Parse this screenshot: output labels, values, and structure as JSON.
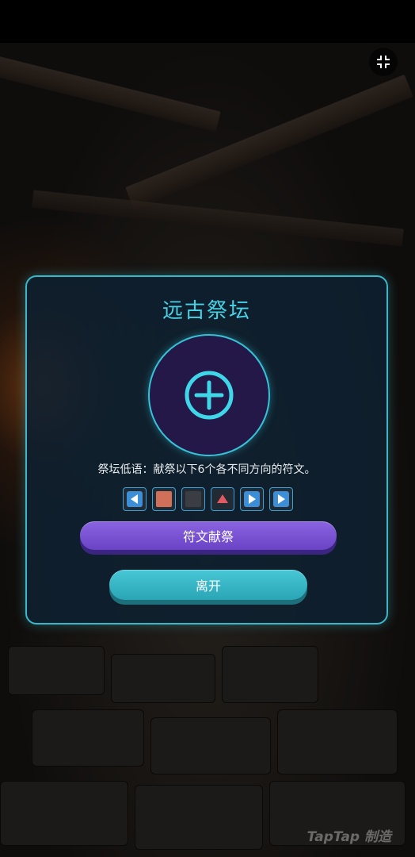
{
  "dialog": {
    "title": "远古祭坛",
    "hint": "祭坛低语：献祭以下6个各不同方向的符文。",
    "runes": [
      {
        "type": "arrow-left",
        "color": "#4a9be0"
      },
      {
        "type": "square",
        "color": "#d0705a"
      },
      {
        "type": "empty",
        "color": "#3a3e44"
      },
      {
        "type": "arrow-up",
        "color": "#e05a62"
      },
      {
        "type": "arrow-right",
        "color": "#4a9be0"
      },
      {
        "type": "arrow-right",
        "color": "#4a9be0"
      }
    ],
    "offer_label": "符文献祭",
    "leave_label": "离开"
  },
  "watermark": "TapTap 制造",
  "colors": {
    "accent": "#46d3e6",
    "panel_border": "#3ab7c9",
    "offer_button": "#7a54d4",
    "leave_button": "#3ab8c8"
  }
}
